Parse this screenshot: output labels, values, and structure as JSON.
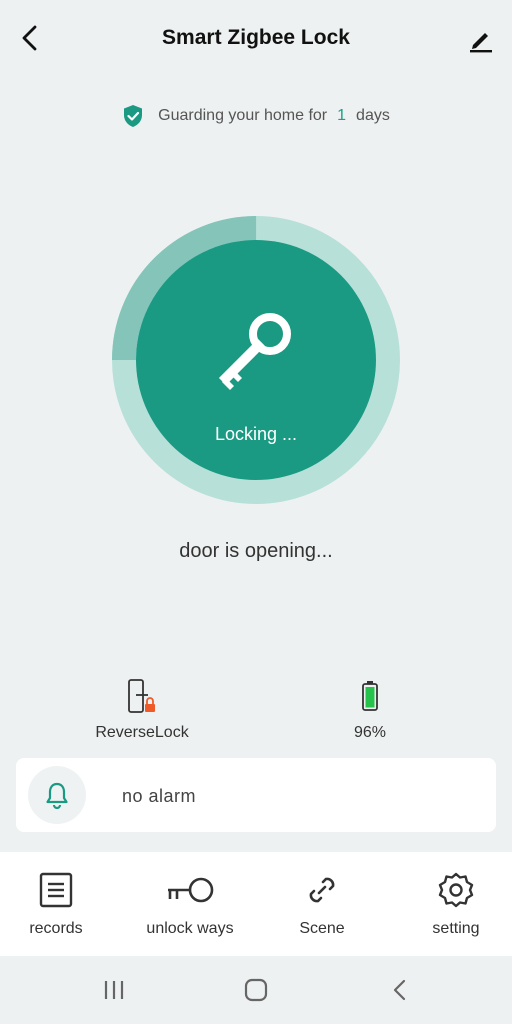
{
  "header": {
    "title": "Smart Zigbee Lock",
    "back_icon": "back-arrow-icon",
    "edit_icon": "pencil-icon"
  },
  "guard": {
    "prefix": "Guarding your home for",
    "days": "1",
    "suffix": "days",
    "icon": "shield-check-icon"
  },
  "lock": {
    "label": "Locking ...",
    "icon": "key-icon",
    "progress_fraction": 0.25
  },
  "status": {
    "text": "door is opening..."
  },
  "info": {
    "reverse_lock": {
      "label": "ReverseLock",
      "icon": "reverse-lock-icon"
    },
    "battery": {
      "label": "96%",
      "icon": "battery-icon"
    }
  },
  "alarm": {
    "text": "no  alarm",
    "icon": "bell-icon"
  },
  "tabs": [
    {
      "label": "records",
      "icon": "records-icon"
    },
    {
      "label": "unlock ways",
      "icon": "key-icon"
    },
    {
      "label": "Scene",
      "icon": "link-icon"
    },
    {
      "label": "setting",
      "icon": "gear-icon"
    }
  ],
  "system_nav": {
    "recents_icon": "recents-icon",
    "home_icon": "home-icon",
    "back_icon": "back-icon"
  },
  "colors": {
    "accent": "#1a9a83",
    "ring_light": "#b7e0d8",
    "ring_dark": "#84c4b9",
    "background": "#eef1f1",
    "lock_badge": "#f05a28",
    "battery": "#27c24c"
  }
}
